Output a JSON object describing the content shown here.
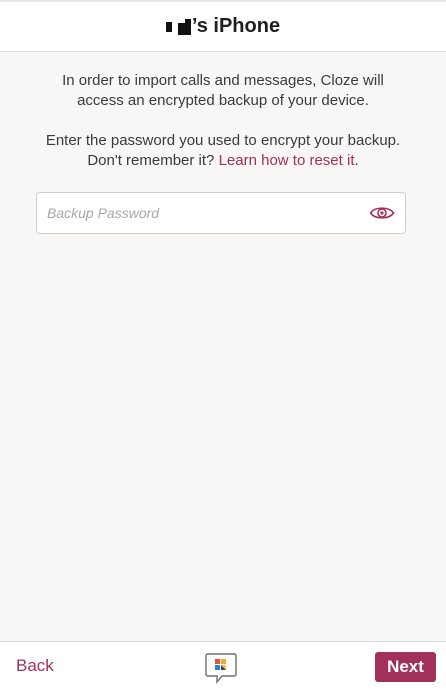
{
  "header": {
    "title_suffix": "’s iPhone"
  },
  "intro": {
    "line1": "In order to import calls and messages, Cloze will access an encrypted backup of your device.",
    "line2_prefix": "Enter the password you used to encrypt your backup. Don't remember it? ",
    "line2_link": "Learn how to reset it",
    "line2_suffix": "."
  },
  "password": {
    "placeholder": "Backup Password",
    "value": ""
  },
  "footer": {
    "back_label": "Back",
    "next_label": "Next"
  },
  "colors": {
    "accent": "#a1305a",
    "background": "#f8f7f5"
  },
  "icons": {
    "eye": "eye-icon",
    "logo": "cloze-logo-icon",
    "redacted_name": "redacted-name"
  }
}
